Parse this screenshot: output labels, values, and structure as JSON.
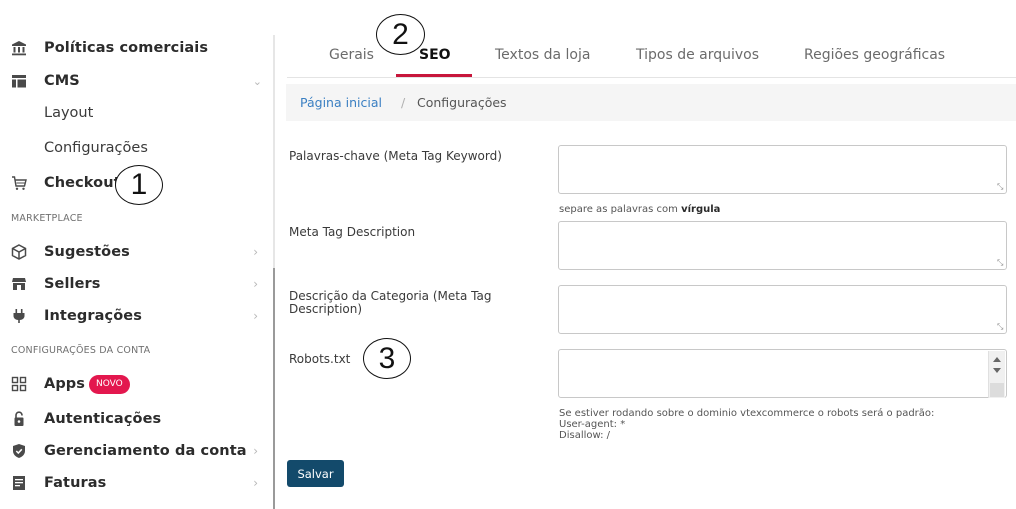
{
  "sidebar": {
    "items": [
      {
        "label": "Políticas comerciais",
        "icon": "bank-icon"
      },
      {
        "label": "CMS",
        "icon": "layout-icon",
        "chevron": "down"
      },
      {
        "label": "Layout"
      },
      {
        "label": "Configurações"
      },
      {
        "label": "Checkout",
        "icon": "cart-icon"
      },
      {
        "label": "Sugestões",
        "icon": "box-icon",
        "chevron": "right"
      },
      {
        "label": "Sellers",
        "icon": "store-icon",
        "chevron": "right"
      },
      {
        "label": "Integrações",
        "icon": "plug-icon",
        "chevron": "right"
      },
      {
        "label": "Apps",
        "icon": "apps-icon",
        "badge": "NOVO"
      },
      {
        "label": "Autenticações",
        "icon": "lock-icon"
      },
      {
        "label": "Gerenciamento da conta",
        "icon": "shield-icon",
        "chevron": "right"
      },
      {
        "label": "Faturas",
        "icon": "invoice-icon",
        "chevron": "right"
      }
    ],
    "sections": {
      "marketplace": "MARKETPLACE",
      "account": "CONFIGURAÇÕES DA CONTA"
    }
  },
  "tabs": [
    {
      "label": "Gerais"
    },
    {
      "label": "SEO",
      "active": true
    },
    {
      "label": "Textos da loja"
    },
    {
      "label": "Tipos de arquivos"
    },
    {
      "label": "Regiões geográficas"
    }
  ],
  "breadcrumb": {
    "home": "Página inicial",
    "separator": "/",
    "current": "Configurações"
  },
  "form": {
    "keywords_label": "Palavras-chave (Meta Tag Keyword)",
    "keywords_value": "",
    "keywords_hint_prefix": "separe as palavras com",
    "keywords_hint_bold": "vírgula",
    "description_label": "Meta Tag Description",
    "description_value": "",
    "category_description_label_line1": "Descrição da Categoria (Meta Tag",
    "category_description_label_line2": "Description)",
    "category_description_value": "",
    "robots_label": "Robots.txt",
    "robots_value": "",
    "robots_hint_line1": "Se estiver rodando sobre o dominio vtexcommerce o robots será o padrão:",
    "robots_hint_line2": "User-agent: *",
    "robots_hint_line3": "Disallow: /",
    "save_label": "Salvar"
  },
  "annotations": [
    "1",
    "2",
    "3"
  ],
  "colors": {
    "accent": "#c7163b",
    "badge": "#e3174e",
    "link": "#3a7fc2",
    "button": "#134a6b"
  }
}
